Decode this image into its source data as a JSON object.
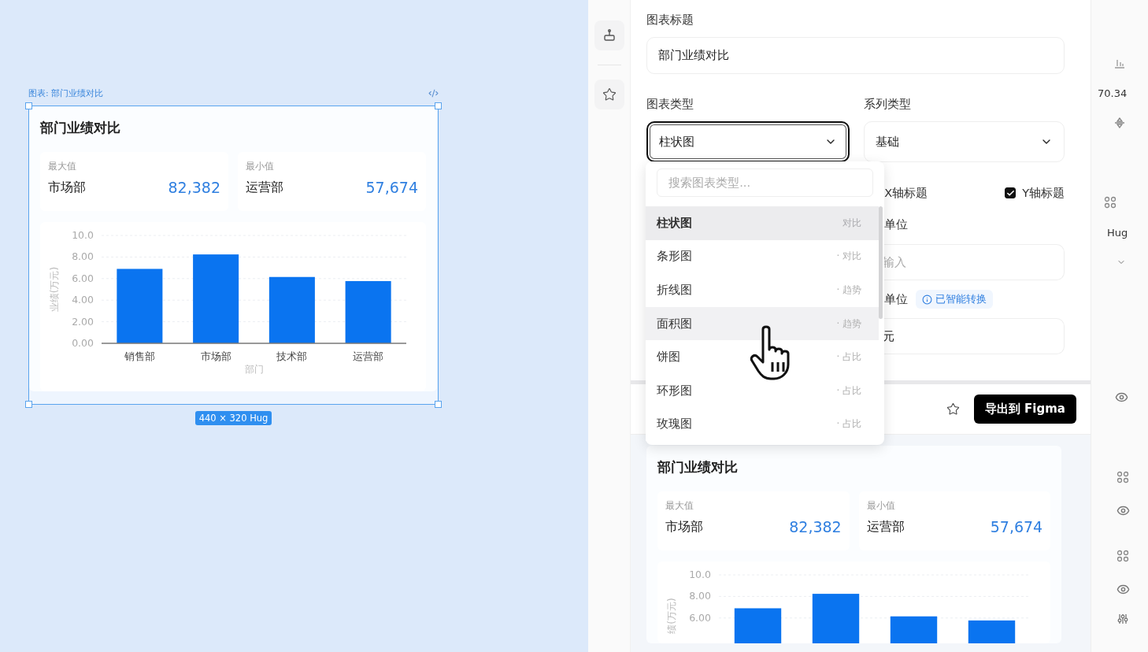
{
  "canvas": {
    "frame_label": "图表: 部门业绩对比",
    "size_badge": "440 × 320 Hug",
    "card": {
      "title": "部门业绩对比",
      "stats": [
        {
          "label": "最大值",
          "name": "市场部",
          "value": "82,382"
        },
        {
          "label": "最小值",
          "name": "运营部",
          "value": "57,674"
        }
      ],
      "chart_data": {
        "type": "bar",
        "xlabel": "部门",
        "ylabel": "业绩(万元)",
        "categories": [
          "销售部",
          "市场部",
          "技术部",
          "运营部"
        ],
        "series": [
          {
            "color": "#0a74f0",
            "values": [
              6.9,
              8.24,
              6.15,
              5.77
            ]
          }
        ],
        "grid": true,
        "ylim": [
          0,
          10
        ],
        "yticks": [
          {
            "value": 0,
            "label": "0.00"
          },
          {
            "value": 2,
            "label": "2.00"
          },
          {
            "value": 4,
            "label": "4.00"
          },
          {
            "value": 6,
            "label": "6.00"
          },
          {
            "value": 8,
            "label": "8.00"
          },
          {
            "value": 10,
            "label": "10.0"
          }
        ]
      }
    }
  },
  "form": {
    "title_field": {
      "label": "图表标题",
      "value": "部门业绩对比"
    },
    "chart_type": {
      "label": "图表类型",
      "value": "柱状图",
      "focused": true
    },
    "series_type": {
      "label": "系列类型",
      "value": "基础"
    },
    "x_axis_title": {
      "label": "X轴标题"
    },
    "y_axis_title": {
      "label": "Y轴标题",
      "checked": true
    },
    "unit_label": "单位",
    "unit_field": {
      "placeholder": "输入"
    },
    "display_unit": {
      "label": "单位",
      "badge": "已智能转换",
      "value": "元"
    }
  },
  "dropdown": {
    "search_placeholder": "搜索图表类型...",
    "items": [
      {
        "label": "柱状图",
        "tag": "对比",
        "selected": true,
        "hovered": false
      },
      {
        "label": "条形图",
        "tag": "· 对比",
        "selected": false,
        "hovered": false
      },
      {
        "label": "折线图",
        "tag": "· 趋势",
        "selected": false,
        "hovered": false
      },
      {
        "label": "面积图",
        "tag": "· 趋势",
        "selected": false,
        "hovered": true
      },
      {
        "label": "饼图",
        "tag": "· 占比",
        "selected": false,
        "hovered": false
      },
      {
        "label": "环形图",
        "tag": "· 占比",
        "selected": false,
        "hovered": false
      },
      {
        "label": "玫瑰图",
        "tag": "· 占比",
        "selected": false,
        "hovered": false
      }
    ]
  },
  "toolbar": {
    "export_button": "导出到 Figma"
  },
  "preview": {
    "card": {
      "title": "部门业绩对比",
      "stats": [
        {
          "label": "最大值",
          "name": "市场部",
          "value": "82,382"
        },
        {
          "label": "最小值",
          "name": "运营部",
          "value": "57,674"
        }
      ],
      "chart_data": {
        "type": "bar",
        "ylabel": "绩(万元)",
        "series": [
          {
            "color": "#0a74f0",
            "values": [
              6.9,
              8.24,
              6.15,
              5.77
            ]
          }
        ],
        "grid": true,
        "ylim": [
          0,
          10
        ],
        "yticks": [
          {
            "value": 6,
            "label": "6.00"
          },
          {
            "value": 8,
            "label": "8.00"
          },
          {
            "value": 10,
            "label": "10.0"
          }
        ]
      }
    }
  },
  "inspector": {
    "values": [
      "70.34",
      "Hug"
    ]
  }
}
